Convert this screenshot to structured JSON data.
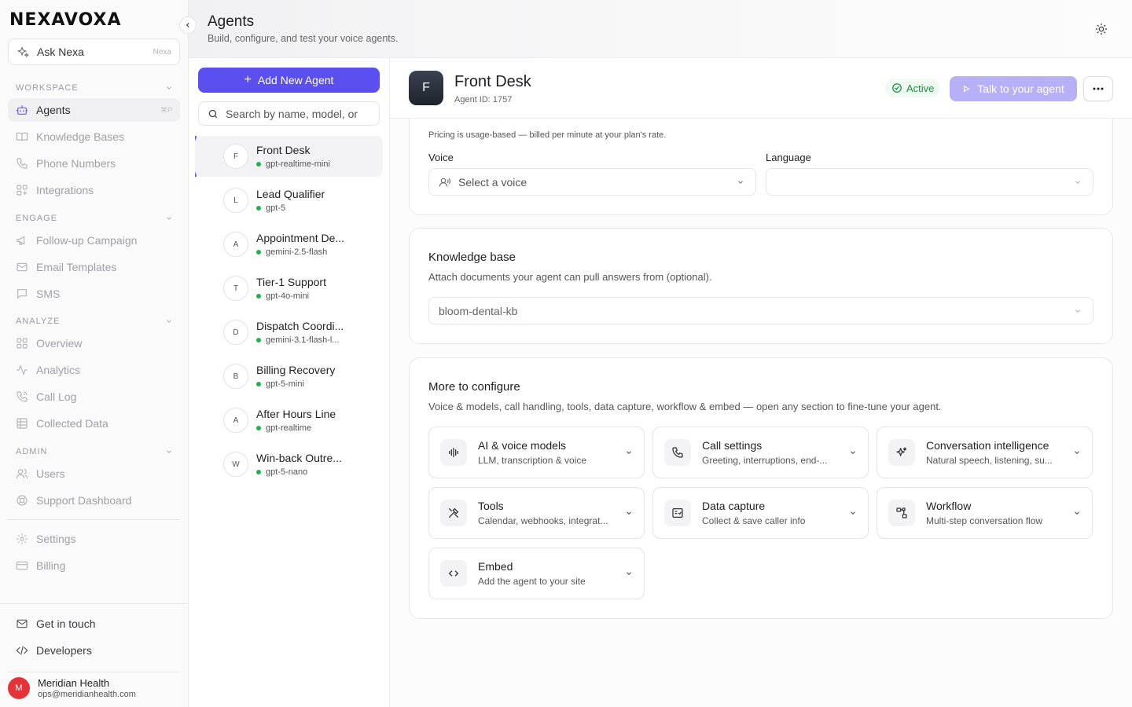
{
  "brand": {
    "logo_text": "NEXAVOXA"
  },
  "ask": {
    "label": "Ask Nexa",
    "tag": "Nexa"
  },
  "sidebar": {
    "sections": [
      {
        "title": "WORKSPACE",
        "items": [
          {
            "label": "Agents",
            "icon": "bot-icon",
            "shortcut": "⌘P",
            "active": true
          },
          {
            "label": "Knowledge Bases",
            "icon": "book-icon"
          },
          {
            "label": "Phone Numbers",
            "icon": "phone-icon"
          },
          {
            "label": "Integrations",
            "icon": "integrations-icon"
          }
        ]
      },
      {
        "title": "ENGAGE",
        "items": [
          {
            "label": "Follow-up Campaign",
            "icon": "megaphone-icon"
          },
          {
            "label": "Email Templates",
            "icon": "mail-icon"
          },
          {
            "label": "SMS",
            "icon": "message-icon"
          }
        ]
      },
      {
        "title": "ANALYZE",
        "items": [
          {
            "label": "Overview",
            "icon": "grid-icon"
          },
          {
            "label": "Analytics",
            "icon": "activity-icon"
          },
          {
            "label": "Call Log",
            "icon": "phone-call-icon"
          },
          {
            "label": "Collected Data",
            "icon": "table-icon"
          }
        ]
      },
      {
        "title": "ADMIN",
        "items": [
          {
            "label": "Users",
            "icon": "users-icon"
          },
          {
            "label": "Support Dashboard",
            "icon": "lifebuoy-icon"
          }
        ]
      }
    ],
    "bottom_items": [
      {
        "label": "Settings",
        "icon": "gear-icon"
      },
      {
        "label": "Billing",
        "icon": "card-icon"
      }
    ],
    "footer_items": [
      {
        "label": "Get in touch",
        "icon": "mail-icon"
      },
      {
        "label": "Developers",
        "icon": "code-icon"
      }
    ],
    "user": {
      "initial": "M",
      "name": "Meridian Health",
      "email": "ops@meridianhealth.com"
    }
  },
  "header": {
    "title": "Agents",
    "subtitle": "Build, configure, and test your voice agents."
  },
  "agent_list": {
    "add_label": "Add New Agent",
    "search_placeholder": "Search by name, model, or ID",
    "agents": [
      {
        "initial": "F",
        "name": "Front Desk",
        "model": "gpt-realtime-mini",
        "selected": true
      },
      {
        "initial": "L",
        "name": "Lead Qualifier",
        "model": "gpt-5"
      },
      {
        "initial": "A",
        "name": "Appointment De...",
        "model": "gemini-2.5-flash"
      },
      {
        "initial": "T",
        "name": "Tier-1 Support",
        "model": "gpt-4o-mini"
      },
      {
        "initial": "D",
        "name": "Dispatch Coordi...",
        "model": "gemini-3.1-flash-l..."
      },
      {
        "initial": "B",
        "name": "Billing Recovery",
        "model": "gpt-5-mini"
      },
      {
        "initial": "A",
        "name": "After Hours Line",
        "model": "gpt-realtime"
      },
      {
        "initial": "W",
        "name": "Win-back Outre...",
        "model": "gpt-5-nano"
      }
    ]
  },
  "detail": {
    "initial": "F",
    "name": "Front Desk",
    "agent_id": "Agent ID: 1757",
    "status": "Active",
    "talk_label": "Talk to your agent",
    "pricing_note": "Pricing is usage-based — billed per minute at your plan's rate.",
    "voice": {
      "label": "Voice",
      "placeholder": "Select a voice"
    },
    "language": {
      "label": "Language",
      "value": ""
    },
    "knowledge": {
      "title": "Knowledge base",
      "subtitle": "Attach documents your agent can pull answers from (optional).",
      "value": "bloom-dental-kb"
    },
    "more": {
      "title": "More to configure",
      "subtitle": "Voice & models, call handling, tools, data capture, workflow & embed — open any section to fine-tune your agent.",
      "tiles": [
        {
          "title": "AI & voice models",
          "subtitle": "LLM, transcription & voice",
          "icon": "audio-wave-icon"
        },
        {
          "title": "Call settings",
          "subtitle": "Greeting, interruptions, end-...",
          "icon": "phone-settings-icon"
        },
        {
          "title": "Conversation intelligence",
          "subtitle": "Natural speech, listening, su...",
          "icon": "sparkles-icon"
        },
        {
          "title": "Tools",
          "subtitle": "Calendar, webhooks, integrat...",
          "icon": "tools-icon"
        },
        {
          "title": "Data capture",
          "subtitle": "Collect & save caller info",
          "icon": "form-icon"
        },
        {
          "title": "Workflow",
          "subtitle": "Multi-step conversation flow",
          "icon": "workflow-icon"
        },
        {
          "title": "Embed",
          "subtitle": "Add the agent to your site",
          "icon": "code-icon"
        }
      ]
    }
  },
  "colors": {
    "accent": "#5b4ff0",
    "accent_light": "#b6b1f6",
    "active_green": "#22b34c",
    "avatar_red": "#e5333a"
  }
}
